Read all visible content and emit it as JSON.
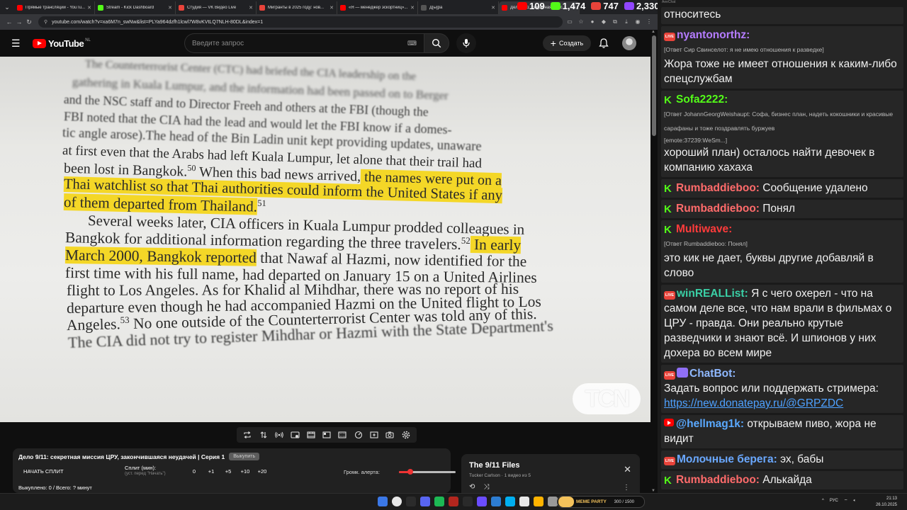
{
  "browser": {
    "tabs": [
      {
        "title": "Прямые трансляции - YouTu...",
        "favicon_color": "#ff0000"
      },
      {
        "title": "Stream - Kick Dashboard",
        "favicon_color": "#53fc18"
      },
      {
        "title": "Студия — VK Видео Live",
        "favicon_color": "#e8433a"
      },
      {
        "title": "Мигранты в 2025 году: нов...",
        "favicon_color": "#e8433a"
      },
      {
        "title": "«Я — менеджер эскортниц»...",
        "favicon_color": "#ff0000"
      },
      {
        "title": "Д[ы]ра",
        "favicon_color": "#555555"
      },
      {
        "title": "Дело 9/11: секретная мисс...",
        "favicon_color": "#ff0000"
      }
    ],
    "url": "youtube.com/watch?v=xa6M7n_swNw&list=PLYa964dzfh1lcwl7W8vKVtLQ7NLH-80DL&index=1"
  },
  "stream_stats": [
    {
      "platform": "youtube",
      "value": "109",
      "color": "#ff0000"
    },
    {
      "platform": "kick",
      "value": "1,474",
      "color": "#53fc18"
    },
    {
      "platform": "vk",
      "value": "747",
      "color": "#e8433a"
    },
    {
      "platform": "twitch",
      "value": "2,330",
      "color": "#9146ff"
    }
  ],
  "youtube": {
    "logo_text": "YouTube",
    "region": "NL",
    "search_placeholder": "Введите запрос",
    "create_label": "Создать"
  },
  "video": {
    "watermark": "TCN",
    "lines": [
      {
        "text": "The Counterterrorist Center (CTC) had briefed the CIA leadership on the",
        "blur": 1
      },
      {
        "text": "gathering in Kuala Lumpur, and the information had been passed on to Berger",
        "blur": 1
      },
      {
        "text": "and the NSC staff and to Director Freeh and others at the FBI (though the",
        "blur": 2
      },
      {
        "text": "FBI noted that the CIA had the lead and would let the FBI know if a domes-",
        "blur": 2
      },
      {
        "text": "tic angle arose).The head of the Bin Ladin unit kept providing updates, unaware",
        "blur": 2
      },
      {
        "text": "at first even that the Arabs had left Kuala Lumpur, let alone that their trail had",
        "blur": 0
      },
      {
        "pre": "been lost in Bangkok.",
        "sup": "50",
        "post": " When this bad news arrived,",
        "hl": " the names were put on a"
      },
      {
        "hl": "Thai watchlist so that Thai authorities could inform the United States if any"
      },
      {
        "hl": "of them departed from Thailand.",
        "sup": "51"
      },
      {
        "text": "Several weeks later, CIA officers in Kuala Lumpur prodded colleagues in",
        "indent": true
      },
      {
        "pre": "Bangkok for additional information regarding the three travelers.",
        "sup": "52",
        "hl": " In early"
      },
      {
        "hl": "March 2000, Bangkok reported",
        "post": " that Nawaf al Hazmi, now identified for the"
      },
      {
        "text": "first time with his full name, had departed on January 15 on a United Airlines"
      },
      {
        "text": "flight to Los Angeles. As for Khalid al Mihdhar, there was no report of his"
      },
      {
        "text": "departure even though he had accompanied Hazmi on the United flight to Los"
      },
      {
        "pre": "Angeles.",
        "sup": "53",
        "post": " No one outside of the Counterterrorist Center was told any of this."
      },
      {
        "text": "The CIA did not try to register Mihdhar or Hazmi with the State Department's",
        "blur": 2
      }
    ]
  },
  "split_panel": {
    "title": "Дело 9/11: секретная миссия ЦРУ, закончившаяся неудачей | Серия 1",
    "title_button": "Выкупить",
    "start_split": "НАЧАТЬ СПЛИТ",
    "split_label": "Сплит (мин):",
    "split_hint": "(уст. перед \"Начать\")",
    "split_values": [
      "0",
      "+1",
      "+5",
      "+10",
      "+20"
    ],
    "alert_label": "Громк. алерта:",
    "alert_volume": 0.2,
    "footer": "Выкуплено: 0 / Всего: ? минут"
  },
  "playlist": {
    "title": "The 9/11 Files",
    "subtitle": "Tucker Carlson · 1 видео из 5"
  },
  "chat": {
    "top_label": "AeeChat",
    "messages": [
      {
        "platform": "",
        "user": "",
        "user_color": "#ffffff",
        "text": "относитесь"
      },
      {
        "platform": "vk",
        "user": "nyantonorthz:",
        "user_color": "#b57cff",
        "reply": "[Ответ Сир Свинселот: я не имею отношения к разведке]",
        "text": "Жора тоже не имеет отношения к каким-либо спецслужбам"
      },
      {
        "platform": "kick",
        "user": "Sofa2222:",
        "user_color": "#53fc18",
        "reply": "[Ответ JohannGeorgWeishaupt: Софа, бизнес план, надеть кокошники и красивые сарафаны и тоже поздравлять буржуев",
        "emote": "[emote:37239:WeSm...]",
        "text": "хороший план) осталось найти девочек в компанию хахаха"
      },
      {
        "platform": "kick",
        "user": "Rumbaddieboo:",
        "user_color": "#ff6b6b",
        "text": "Сообщение удалено"
      },
      {
        "platform": "kick",
        "user": "Rumbaddieboo:",
        "user_color": "#ff6b6b",
        "text": "Понял"
      },
      {
        "platform": "kick",
        "user": "Multiwave:",
        "user_color": "#ff3b3b",
        "reply": "[Ответ Rumbaddieboo: Понял]",
        "text": "это кик не дает, буквы другие добавляй в слово"
      },
      {
        "platform": "vk",
        "user": "winREALList:",
        "user_color": "#3ad0a6",
        "text": "Я с чего охерел - что на самом деле все, что нам врали в фильмах о ЦРУ - правда. Они реально крутые разведчики и знают всё. И шпионов у них дохера во всем мире"
      },
      {
        "platform": "vk-bot",
        "user": "ChatBot:",
        "user_color": "#8fb8ff",
        "text": "Задать вопрос или поддержать стримера:",
        "link": "https://new.donatepay.ru/@GRPZDC"
      },
      {
        "platform": "youtube",
        "user": "@hellmag1k:",
        "user_color": "#5aa9ff",
        "text": "открываем пиво, жора не видит"
      },
      {
        "platform": "vk",
        "user": "Молочные берега:",
        "user_color": "#6aa8ff",
        "text": "эх, бабы"
      },
      {
        "platform": "kick",
        "user": "Rumbaddieboo:",
        "user_color": "#ff6b6b",
        "text": "Алькайда"
      }
    ]
  },
  "taskbar": {
    "party_title": "MEME PARTY",
    "party_count": "300 / 1500",
    "lang": "РУС",
    "time": "21:13",
    "date": "26.10.2025",
    "app_colors": [
      "#3b78e7",
      "#e8e8e8",
      "#2b2b2b",
      "#5865f2",
      "#1db954",
      "#b3261e",
      "#2a2a2a",
      "#6a4cff",
      "#2d7dd2",
      "#00aff0",
      "#e8e8e8",
      "#ffb300",
      "#999999",
      "#4a4a4a"
    ]
  }
}
